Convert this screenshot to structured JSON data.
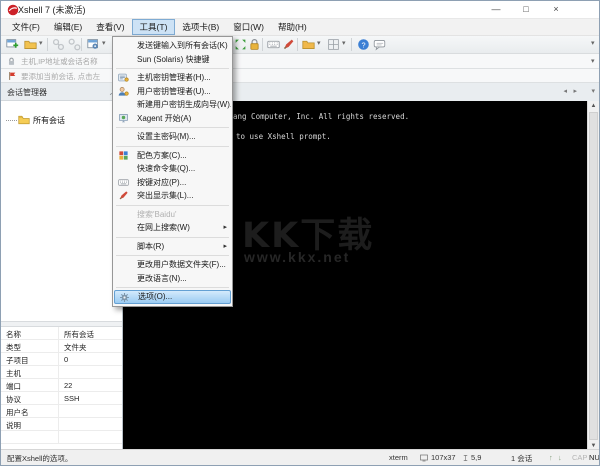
{
  "window": {
    "title": "Xshell 7 (未激活)",
    "controls": {
      "minimize": "—",
      "maximize": "□",
      "close": "×"
    }
  },
  "menu_bar": {
    "items": [
      {
        "label": "文件(F)"
      },
      {
        "label": "编辑(E)"
      },
      {
        "label": "查看(V)"
      },
      {
        "label": "工具(T)"
      },
      {
        "label": "选项卡(B)"
      },
      {
        "label": "窗口(W)"
      },
      {
        "label": "帮助(H)"
      }
    ]
  },
  "tools_menu": {
    "items": [
      {
        "label": "发送键输入到所有会话(K)"
      },
      {
        "label": "Sun (Solaris) 快捷键"
      },
      {
        "label": "主机密钥管理者(H)..."
      },
      {
        "label": "用户密钥管理者(U)..."
      },
      {
        "label": "新建用户密钥生成向导(W)..."
      },
      {
        "label": "Xagent 开始(A)"
      },
      {
        "label": "设置主密码(M)..."
      },
      {
        "label": "配色方案(C)..."
      },
      {
        "label": "快速命令集(Q)..."
      },
      {
        "label": "按键对应(P)..."
      },
      {
        "label": "突出显示集(L)..."
      },
      {
        "label": "搜索'Baidu'"
      },
      {
        "label": "在网上搜索(W)"
      },
      {
        "label": "脚本(R)"
      },
      {
        "label": "更改用户数据文件夹(F)..."
      },
      {
        "label": "更改语言(N)..."
      },
      {
        "label": "选项(O)..."
      }
    ]
  },
  "address_bar": {
    "placeholder": "主机,IP地址或会话名称"
  },
  "links_bar": {
    "hint": "要添加当前会话, 点击左"
  },
  "session_panel": {
    "title": "会话管理器",
    "root_node": "所有会话"
  },
  "properties": {
    "rows": [
      {
        "label": "名称",
        "value": "所有会话"
      },
      {
        "label": "类型",
        "value": "文件夹"
      },
      {
        "label": "子项目",
        "value": "0"
      },
      {
        "label": "主机",
        "value": ""
      },
      {
        "label": "端口",
        "value": "22"
      },
      {
        "label": "协议",
        "value": "SSH"
      },
      {
        "label": "用户名",
        "value": ""
      },
      {
        "label": "说明",
        "value": ""
      },
      {
        "label": "",
        "value": ""
      }
    ]
  },
  "terminal": {
    "visible_lines": [
      "ang Computer, Inc. All rights reserved.",
      "to use Xshell prompt."
    ],
    "watermark": {
      "title": "KK下载",
      "url": "www.kkx.net"
    }
  },
  "status_bar": {
    "hint": "配置Xshell的选项。",
    "terminal_type": "xterm",
    "screen_size": "107x37",
    "cursor_position": "5,9",
    "session_count": "1 会话",
    "caps_lock": "CAP",
    "num_lock": "NUM"
  },
  "icons": {
    "dropdown_caret": "▾",
    "submenu_arrow": "▸",
    "tab_scroll_left": "◂",
    "tab_scroll_right": "▸",
    "scroll_up": "▲",
    "scroll_down": "▼",
    "arrow_up": "↑",
    "arrow_down": "↓"
  },
  "colors": {
    "menu_highlight": "#9bcbf2",
    "terminal_background": "#000000",
    "brand_red": "#cc2229"
  }
}
